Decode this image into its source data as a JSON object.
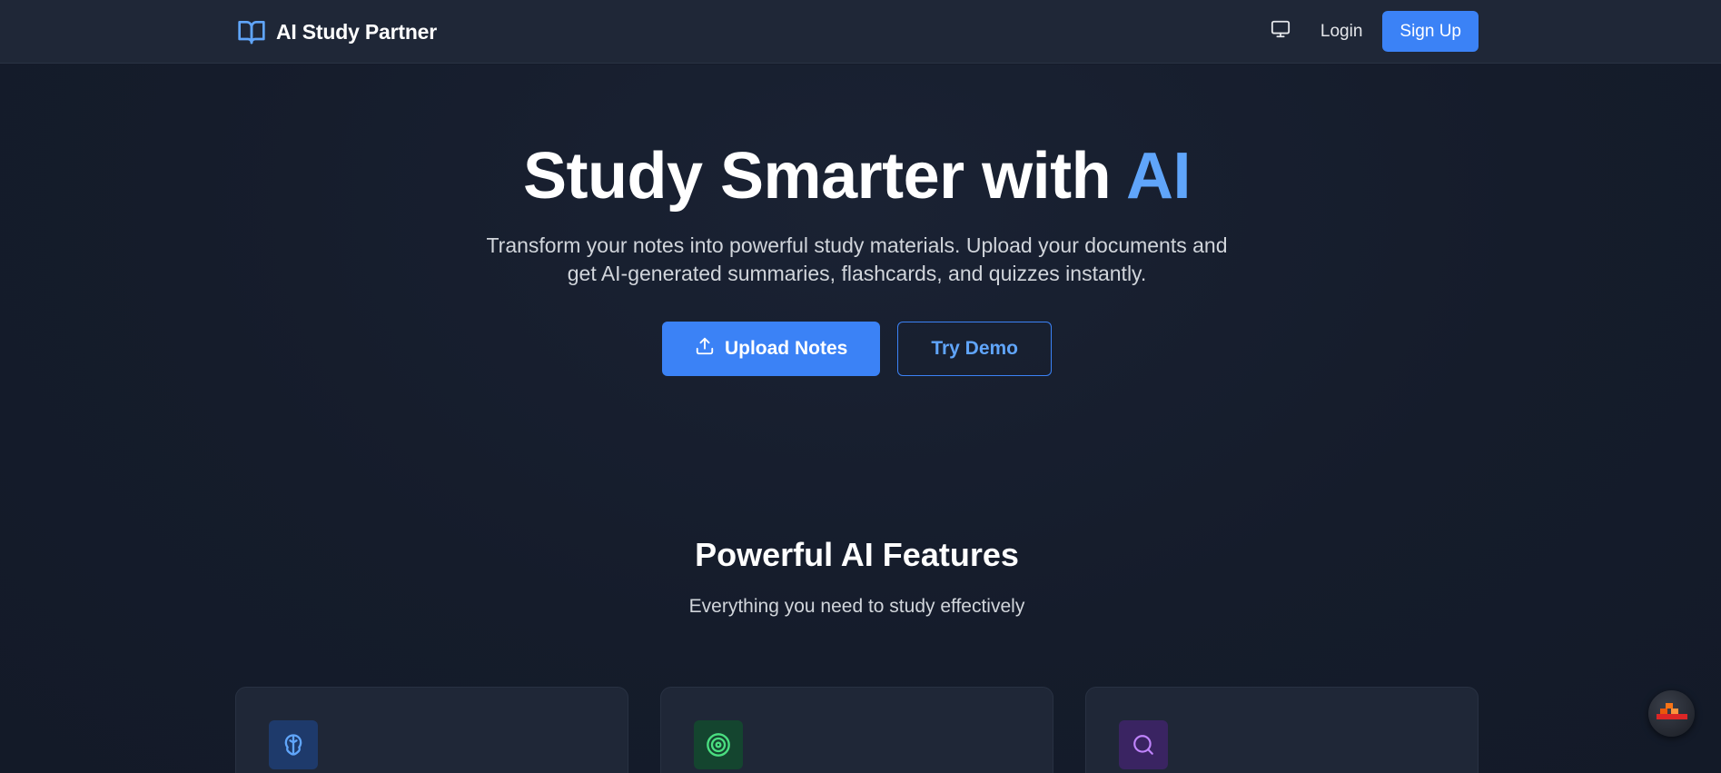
{
  "brand": {
    "title": "AI Study Partner",
    "icon": "open-book-icon"
  },
  "nav": {
    "theme_icon": "monitor-icon",
    "login_label": "Login",
    "signup_label": "Sign Up"
  },
  "hero": {
    "title_main": "Study Smarter with",
    "title_accent": "AI",
    "subtitle": "Transform your notes into powerful study materials. Upload your documents and get AI-generated summaries, flashcards, and quizzes instantly.",
    "upload_label": "Upload Notes",
    "upload_icon": "upload-icon",
    "demo_label": "Try Demo"
  },
  "features": {
    "title": "Powerful AI Features",
    "subtitle": "Everything you need to study effectively",
    "cards": [
      {
        "icon": "brain-icon",
        "color": "#60a5fa"
      },
      {
        "icon": "target-icon",
        "color": "#4ade80"
      },
      {
        "icon": "search-icon",
        "color": "#c084fc"
      }
    ]
  },
  "colors": {
    "accent": "#3b82f6",
    "accent_light": "#60a5fa",
    "background": "#141b2a",
    "navbar": "#1f2737"
  }
}
